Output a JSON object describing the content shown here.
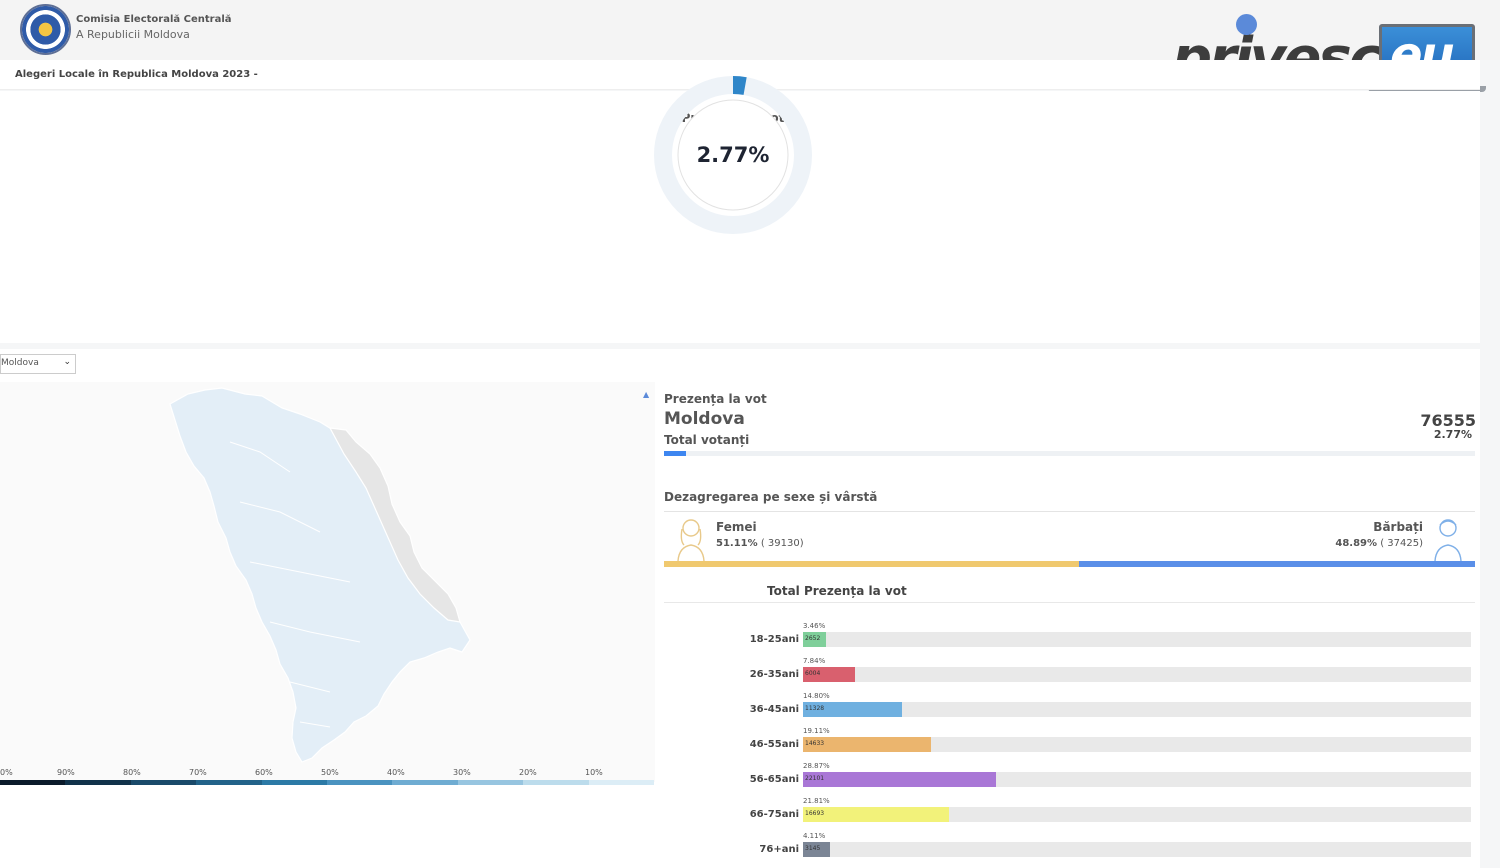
{
  "header": {
    "org_line1": "Comisia Electorală Centrală",
    "org_line2": "A Republicii Moldova",
    "brand_left": "privesc",
    "brand_right": "eu"
  },
  "subheader": {
    "title": "Alegeri Locale în Republica Moldova 2023 -"
  },
  "turnout": {
    "label": "Prezența la vot",
    "count": "76555",
    "percent_text": "2.77%",
    "percent_value": 2.77
  },
  "region_select": {
    "value": "Moldova"
  },
  "map_legend": {
    "ticks": [
      "0%",
      "90%",
      "80%",
      "70%",
      "60%",
      "50%",
      "40%",
      "30%",
      "20%",
      "10%"
    ],
    "colors": [
      "#0b1b2b",
      "#11324a",
      "#1a4a6a",
      "#226389",
      "#2c7aa6",
      "#4a93c0",
      "#6facd2",
      "#97c5e0",
      "#bcdcec",
      "#dcedf6"
    ]
  },
  "region_stats": {
    "label": "Prezența la vot",
    "region": "Moldova",
    "total_label": "Total votanți",
    "count": "76555",
    "percent_text": "2.77%",
    "percent_value": 2.77
  },
  "gender": {
    "title": "Dezagregarea pe sexe și vârstă",
    "female": {
      "label": "Femei",
      "percent": "51.11%",
      "count": "( 39130)",
      "value": 51.11,
      "color": "#f0c96f"
    },
    "male": {
      "label": "Bărbați",
      "percent": "48.89%",
      "count": "( 37425)",
      "value": 48.89,
      "color": "#5a8fe8"
    }
  },
  "age": {
    "title": "Total Prezența la vot",
    "groups": [
      {
        "label": "18-25ani",
        "percent": "3.46%",
        "value": "2652",
        "pct": 3.46,
        "color": "#7fcf9a"
      },
      {
        "label": "26-35ani",
        "percent": "7.84%",
        "value": "6004",
        "pct": 7.84,
        "color": "#d9606e"
      },
      {
        "label": "36-45ani",
        "percent": "14.80%",
        "value": "11328",
        "pct": 14.8,
        "color": "#6fb0e0"
      },
      {
        "label": "46-55ani",
        "percent": "19.11%",
        "value": "14633",
        "pct": 19.11,
        "color": "#ebb56e"
      },
      {
        "label": "56-65ani",
        "percent": "28.87%",
        "value": "22101",
        "pct": 28.87,
        "color": "#a977d6"
      },
      {
        "label": "66-75ani",
        "percent": "21.81%",
        "value": "16693",
        "pct": 21.81,
        "color": "#f2f27a"
      },
      {
        "label": "76+ani",
        "percent": "4.11%",
        "value": "3145",
        "pct": 4.11,
        "color": "#7b8595"
      }
    ]
  }
}
